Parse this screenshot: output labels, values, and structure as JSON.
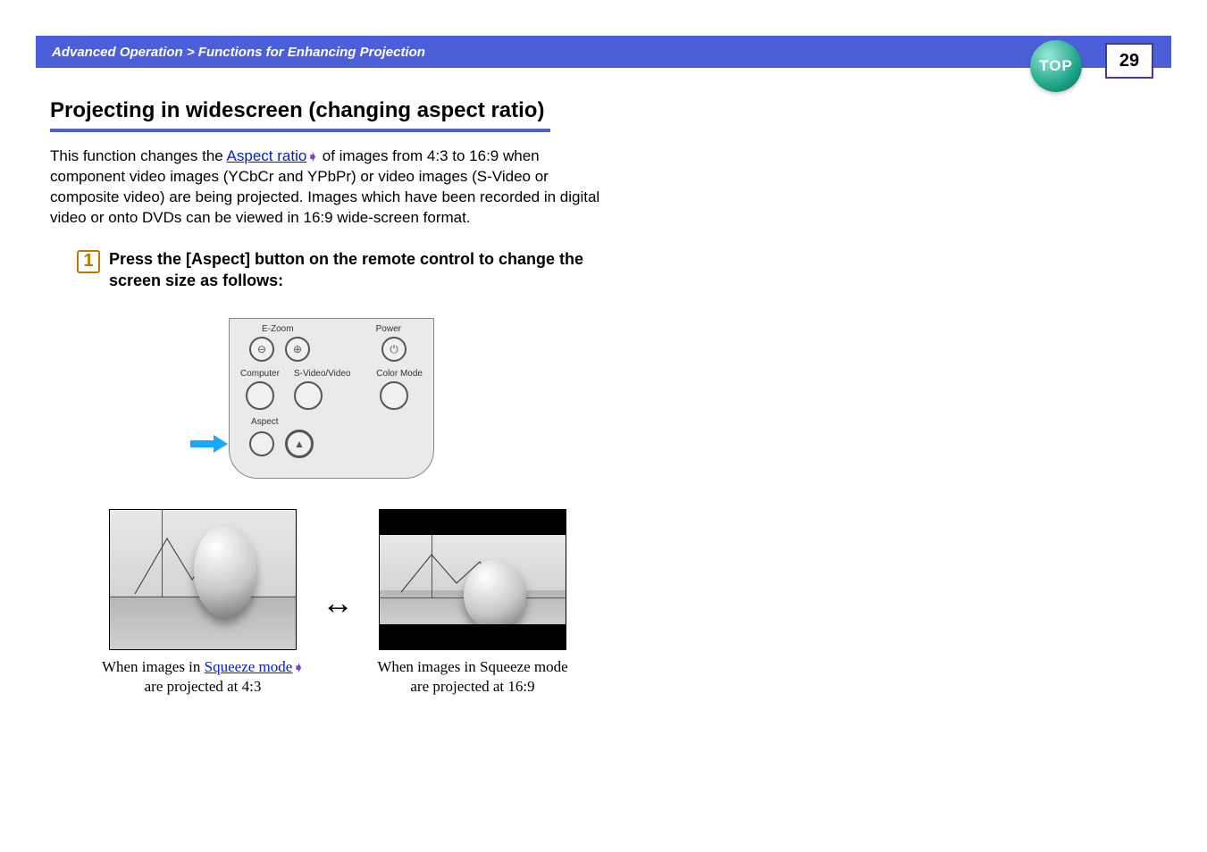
{
  "header": {
    "breadcrumb": "Advanced Operation > Functions for Enhancing Projection",
    "top_label": "TOP",
    "page_number": "29"
  },
  "section": {
    "title": "Projecting in widescreen (changing aspect ratio)"
  },
  "intro": {
    "pre": "This function changes the ",
    "link": "Aspect ratio",
    "post": " of images from 4:3 to 16:9 when component video images (YCbCr and YPbPr) or video images (S-Video or composite video) are being projected. Images which have been recorded in digital video or onto DVDs can be viewed in 16:9 wide-screen format."
  },
  "step": {
    "number": "1",
    "text": "Press the [Aspect] button on the remote control to change the screen size as follows:"
  },
  "remote": {
    "labels": {
      "ezoom": "E-Zoom",
      "power": "Power",
      "computer": "Computer",
      "svideo": "S-Video/Video",
      "colormode": "Color Mode",
      "aspect": "Aspect"
    },
    "glyphs": {
      "minus": "⊖",
      "plus": "⊕",
      "power": "⏻",
      "up": "▲"
    }
  },
  "compare": {
    "arrow": "↔",
    "left": {
      "pre": "When images in ",
      "link": "Squeeze mode",
      "post": " are projected at 4:3"
    },
    "right": {
      "text": "When images in Squeeze mode are projected at 16:9"
    }
  },
  "icons": {
    "glossary": "➧"
  }
}
